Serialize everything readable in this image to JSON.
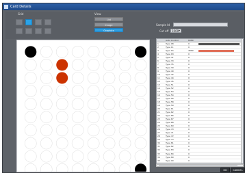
{
  "window": {
    "title": "Card Details"
  },
  "grid": {
    "label": "Grid",
    "buttons_row1": [
      "",
      "",
      "",
      ""
    ],
    "buttons_row2": [
      "",
      "",
      "",
      ""
    ]
  },
  "view": {
    "label": "View",
    "buttons": [
      {
        "label": "List",
        "active": false
      },
      {
        "label": "Image",
        "active": false
      },
      {
        "label": "Graphics",
        "active": true
      }
    ]
  },
  "sample": {
    "label": "Sample Id",
    "value": ""
  },
  "cut_off": {
    "label": "Cut off",
    "value": "1000"
  },
  "plate": {
    "rows": 10,
    "cols": 8,
    "wells": [
      {
        "row": 0,
        "col": 0,
        "state": "black"
      },
      {
        "row": 0,
        "col": 7,
        "state": "black"
      },
      {
        "row": 1,
        "col": 2,
        "state": "red"
      },
      {
        "row": 2,
        "col": 2,
        "state": "red"
      },
      {
        "row": 9,
        "col": 7,
        "state": "black"
      }
    ],
    "colors": {
      "black": "#000000",
      "red": "#cc3300",
      "empty_stroke": "#e2e2e2"
    }
  },
  "table": {
    "headers": [
      "",
      "Auto Control",
      "6980",
      ""
    ],
    "rows": [
      {
        "n": "1",
        "type": "Type 08",
        "val": "0",
        "bar": 1.0,
        "bar_color": "#555555"
      },
      {
        "n": "2",
        "type": "Type 11",
        "val": "0",
        "bar": 0,
        "bar_color": ""
      },
      {
        "n": "3",
        "type": "Type 16",
        "val": "4869",
        "bar": 0.86,
        "bar_color": "#e0705a"
      },
      {
        "n": "4",
        "type": "Type 18",
        "val": "0",
        "bar": 0,
        "bar_color": ""
      },
      {
        "n": "5",
        "type": "Type 31",
        "val": "0",
        "bar": 0,
        "bar_color": ""
      },
      {
        "n": "6",
        "type": "Type 33",
        "val": "0",
        "bar": 0,
        "bar_color": ""
      },
      {
        "n": "7",
        "type": "Type 35",
        "val": "0",
        "bar": 0,
        "bar_color": ""
      },
      {
        "n": "8",
        "type": "Type 39",
        "val": "0",
        "bar": 0,
        "bar_color": ""
      },
      {
        "n": "9",
        "type": "Type 40",
        "val": "0",
        "bar": 0,
        "bar_color": ""
      },
      {
        "n": "10",
        "type": "Type 42",
        "val": "0",
        "bar": 0,
        "bar_color": ""
      },
      {
        "n": "11",
        "type": "Type 44",
        "val": "0",
        "bar": 0,
        "bar_color": ""
      },
      {
        "n": "12",
        "type": "Type 45",
        "val": "0",
        "bar": 0,
        "bar_color": ""
      },
      {
        "n": "13",
        "type": "Type 51",
        "val": "0",
        "bar": 0,
        "bar_color": ""
      },
      {
        "n": "14",
        "type": "Type 52",
        "val": "0",
        "bar": 0,
        "bar_color": ""
      },
      {
        "n": "15",
        "type": "Type 53",
        "val": "0",
        "bar": 0,
        "bar_color": ""
      },
      {
        "n": "16",
        "type": "Type 54",
        "val": "0",
        "bar": 0,
        "bar_color": ""
      },
      {
        "n": "17",
        "type": "Type 56",
        "val": "0",
        "bar": 0,
        "bar_color": ""
      },
      {
        "n": "18",
        "type": "Type 58",
        "val": "0",
        "bar": 0,
        "bar_color": ""
      },
      {
        "n": "19",
        "type": "Type 59",
        "val": "0",
        "bar": 0,
        "bar_color": ""
      },
      {
        "n": "20",
        "type": "Type 61",
        "val": "0",
        "bar": 0,
        "bar_color": ""
      },
      {
        "n": "21",
        "type": "Type 62",
        "val": "0",
        "bar": 0,
        "bar_color": ""
      },
      {
        "n": "22",
        "type": "Type 66",
        "val": "0",
        "bar": 0,
        "bar_color": ""
      },
      {
        "n": "23",
        "type": "Type 67",
        "val": "0",
        "bar": 0,
        "bar_color": ""
      },
      {
        "n": "24",
        "type": "Type 68",
        "val": "0",
        "bar": 0,
        "bar_color": ""
      },
      {
        "n": "25",
        "type": "Type 69",
        "val": "0",
        "bar": 0,
        "bar_color": ""
      },
      {
        "n": "26",
        "type": "Type 70",
        "val": "0",
        "bar": 0,
        "bar_color": ""
      },
      {
        "n": "27",
        "type": "Type 71",
        "val": "0",
        "bar": 0,
        "bar_color": ""
      },
      {
        "n": "28",
        "type": "Type 72",
        "val": "0",
        "bar": 0,
        "bar_color": ""
      },
      {
        "n": "29",
        "type": "Type 73",
        "val": "0",
        "bar": 0,
        "bar_color": ""
      },
      {
        "n": "30",
        "type": "Type 81",
        "val": "0",
        "bar": 0,
        "bar_color": ""
      },
      {
        "n": "31",
        "type": "Type 82",
        "val": "0",
        "bar": 0,
        "bar_color": ""
      },
      {
        "n": "32",
        "type": "Type 83",
        "val": "0",
        "bar": 0,
        "bar_color": ""
      },
      {
        "n": "33",
        "type": "Type 84",
        "val": "0",
        "bar": 0,
        "bar_color": ""
      },
      {
        "n": "34",
        "type": "Type 89",
        "val": "0",
        "bar": 0,
        "bar_color": ""
      },
      {
        "n": "35",
        "type": "Type 90",
        "val": "0",
        "bar": 0,
        "bar_color": ""
      }
    ]
  },
  "actions": {
    "ok_label": "OK",
    "cancel_label": "CANCEL"
  }
}
